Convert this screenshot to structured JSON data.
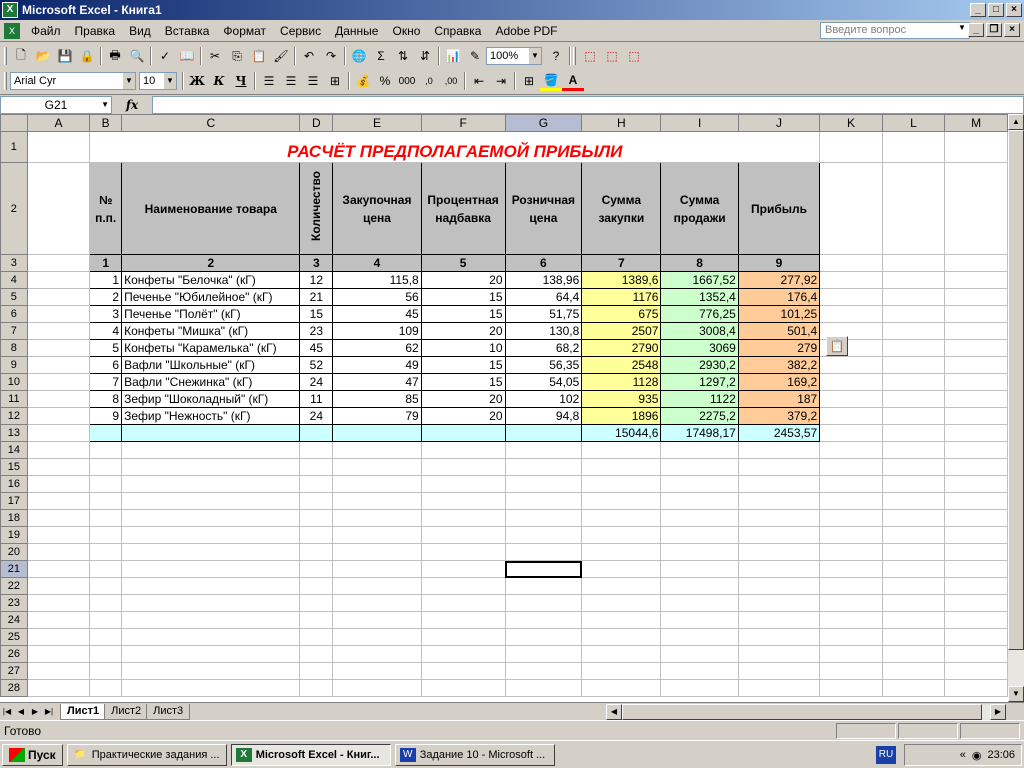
{
  "window": {
    "title": "Microsoft Excel - Книга1"
  },
  "menu": {
    "items": [
      "Файл",
      "Правка",
      "Вид",
      "Вставка",
      "Формат",
      "Сервис",
      "Данные",
      "Окно",
      "Справка",
      "Adobe PDF"
    ],
    "help_placeholder": "Введите вопрос"
  },
  "toolbar": {
    "zoom": "100%",
    "font_name": "Arial Cyr",
    "font_size": "10"
  },
  "formula_bar": {
    "name_box": "G21",
    "fx_label": "fx",
    "formula": ""
  },
  "columns": [
    "A",
    "B",
    "C",
    "D",
    "E",
    "F",
    "G",
    "H",
    "I",
    "J",
    "K",
    "L",
    "M"
  ],
  "selected": {
    "column": "G",
    "row": "21"
  },
  "sheet": {
    "title": "РАСЧЁТ ПРЕДПОЛАГАЕМОЙ ПРИБЫЛИ",
    "headers": [
      "№ п.п.",
      "Наименование товара",
      "Количество",
      "Закупочная цена",
      "Процентная надбавка",
      "Розничная цена",
      "Сумма закупки",
      "Сумма продажи",
      "Прибыль"
    ],
    "header_numbers": [
      "1",
      "2",
      "3",
      "4",
      "5",
      "6",
      "7",
      "8",
      "9"
    ],
    "rows": [
      [
        "1",
        "Конфеты \"Белочка\" (кГ)",
        "12",
        "115,8",
        "20",
        "138,96",
        "1389,6",
        "1667,52",
        "277,92"
      ],
      [
        "2",
        "Печенье \"Юбилейное\" (кГ)",
        "21",
        "56",
        "15",
        "64,4",
        "1176",
        "1352,4",
        "176,4"
      ],
      [
        "3",
        "Печенье \"Полёт\" (кГ)",
        "15",
        "45",
        "15",
        "51,75",
        "675",
        "776,25",
        "101,25"
      ],
      [
        "4",
        "Конфеты \"Мишка\" (кГ)",
        "23",
        "109",
        "20",
        "130,8",
        "2507",
        "3008,4",
        "501,4"
      ],
      [
        "5",
        "Конфеты \"Карамелька\" (кГ)",
        "45",
        "62",
        "10",
        "68,2",
        "2790",
        "3069",
        "279"
      ],
      [
        "6",
        "Вафли \"Школьные\" (кГ)",
        "52",
        "49",
        "15",
        "56,35",
        "2548",
        "2930,2",
        "382,2"
      ],
      [
        "7",
        "Вафли \"Снежинка\" (кГ)",
        "24",
        "47",
        "15",
        "54,05",
        "1128",
        "1297,2",
        "169,2"
      ],
      [
        "8",
        "Зефир \"Шоколадный\" (кГ)",
        "11",
        "85",
        "20",
        "102",
        "935",
        "1122",
        "187"
      ],
      [
        "9",
        "Зефир \"Нежность\" (кГ)",
        "24",
        "79",
        "20",
        "94,8",
        "1896",
        "2275,2",
        "379,2"
      ]
    ],
    "totals": [
      "15044,6",
      "17498,17",
      "2453,57"
    ]
  },
  "tabs": [
    "Лист1",
    "Лист2",
    "Лист3"
  ],
  "status": {
    "text": "Готово"
  },
  "taskbar": {
    "start": "Пуск",
    "buttons": [
      "Практические задания ...",
      "Microsoft Excel - Книг...",
      "Задание 10 - Microsoft ..."
    ],
    "lang": "RU",
    "clock": "23:06"
  },
  "colors": {
    "title_red": "#ff0000",
    "sum_buy": "#ffff99",
    "sum_sell": "#ccffcc",
    "profit": "#ffcc99",
    "total_row": "#ccffff"
  }
}
